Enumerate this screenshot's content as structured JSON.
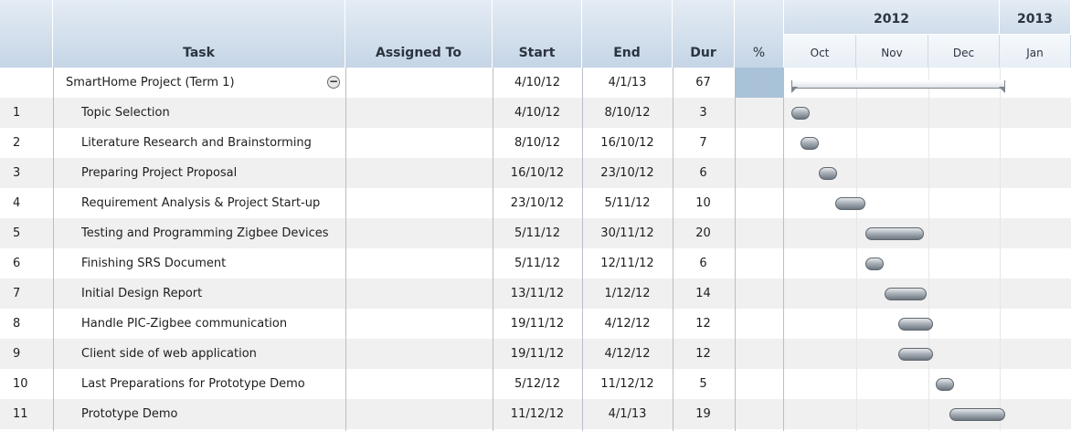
{
  "header": {
    "task": "Task",
    "assigned": "Assigned To",
    "start": "Start",
    "end": "End",
    "dur": "Dur",
    "pct": "%",
    "years": [
      "2012",
      "2013"
    ],
    "months": [
      "Oct",
      "Nov",
      "Dec",
      "Jan"
    ]
  },
  "summary": {
    "name": "SmartHome Project (Term 1)",
    "start": "4/10/12",
    "end": "4/1/13",
    "dur": "67",
    "collapse_glyph": "−",
    "start_date": "2012-10-04",
    "end_date": "2013-01-04"
  },
  "tasks": [
    {
      "num": "1",
      "name": "Topic Selection",
      "start": "4/10/12",
      "end": "8/10/12",
      "dur": "3",
      "start_date": "2012-10-04",
      "end_date": "2012-10-08"
    },
    {
      "num": "2",
      "name": "Literature Research and Brainstorming",
      "start": "8/10/12",
      "end": "16/10/12",
      "dur": "7",
      "start_date": "2012-10-08",
      "end_date": "2012-10-16"
    },
    {
      "num": "3",
      "name": "Preparing Project Proposal",
      "start": "16/10/12",
      "end": "23/10/12",
      "dur": "6",
      "start_date": "2012-10-16",
      "end_date": "2012-10-23"
    },
    {
      "num": "4",
      "name": "Requirement Analysis & Project Start-up",
      "start": "23/10/12",
      "end": "5/11/12",
      "dur": "10",
      "start_date": "2012-10-23",
      "end_date": "2012-11-05"
    },
    {
      "num": "5",
      "name": "Testing and Programming Zigbee Devices",
      "start": "5/11/12",
      "end": "30/11/12",
      "dur": "20",
      "start_date": "2012-11-05",
      "end_date": "2012-11-30"
    },
    {
      "num": "6",
      "name": "Finishing SRS Document",
      "start": "5/11/12",
      "end": "12/11/12",
      "dur": "6",
      "start_date": "2012-11-05",
      "end_date": "2012-11-12"
    },
    {
      "num": "7",
      "name": "Initial Design Report",
      "start": "13/11/12",
      "end": "1/12/12",
      "dur": "14",
      "start_date": "2012-11-13",
      "end_date": "2012-12-01"
    },
    {
      "num": "8",
      "name": "Handle PIC-Zigbee communication",
      "start": "19/11/12",
      "end": "4/12/12",
      "dur": "12",
      "start_date": "2012-11-19",
      "end_date": "2012-12-04"
    },
    {
      "num": "9",
      "name": "Client side of web application",
      "start": "19/11/12",
      "end": "4/12/12",
      "dur": "12",
      "start_date": "2012-11-19",
      "end_date": "2012-12-04"
    },
    {
      "num": "10",
      "name": "Last Preparations for Prototype Demo",
      "start": "5/12/12",
      "end": "11/12/12",
      "dur": "5",
      "start_date": "2012-12-05",
      "end_date": "2012-12-11"
    },
    {
      "num": "11",
      "name": "Prototype Demo",
      "start": "11/12/12",
      "end": "4/1/13",
      "dur": "19",
      "start_date": "2012-12-11",
      "end_date": "2013-01-04"
    }
  ]
}
